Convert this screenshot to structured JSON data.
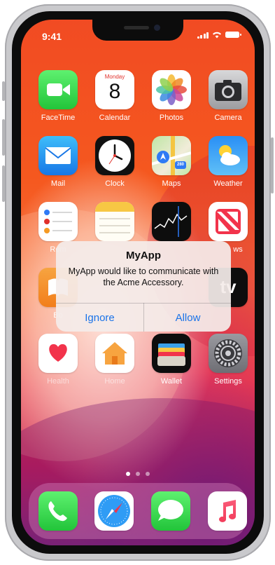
{
  "status_bar": {
    "time": "9:41"
  },
  "home": {
    "apps": [
      {
        "label": "FaceTime",
        "icon": "facetime-icon"
      },
      {
        "label": "Calendar",
        "icon": "calendar-icon",
        "calendar_day": "Monday",
        "calendar_date": "8"
      },
      {
        "label": "Photos",
        "icon": "photos-icon"
      },
      {
        "label": "Camera",
        "icon": "camera-icon"
      },
      {
        "label": "Mail",
        "icon": "mail-icon"
      },
      {
        "label": "Clock",
        "icon": "clock-icon"
      },
      {
        "label": "Maps",
        "icon": "maps-icon",
        "route_badge": "280"
      },
      {
        "label": "Weather",
        "icon": "weather-icon"
      },
      {
        "label": "Rem",
        "icon": "reminders-icon"
      },
      {
        "label": "",
        "icon": "notes-icon"
      },
      {
        "label": "",
        "icon": "stocks-icon"
      },
      {
        "label": "ws",
        "icon": "news-icon"
      },
      {
        "label": "Bo",
        "icon": "books-icon"
      },
      {
        "label": "",
        "icon": "tv-icon",
        "tv_text": "tv"
      },
      {
        "label": "Health",
        "icon": "health-icon"
      },
      {
        "label": "Home",
        "icon": "home-icon"
      },
      {
        "label": "Wallet",
        "icon": "wallet-icon"
      },
      {
        "label": "Settings",
        "icon": "settings-icon"
      }
    ],
    "dock": [
      {
        "icon": "phone-icon"
      },
      {
        "icon": "safari-icon"
      },
      {
        "icon": "messages-icon"
      },
      {
        "icon": "music-icon"
      }
    ]
  },
  "alert": {
    "title": "MyApp",
    "message": "MyApp would like to communicate with the Acme Accessory.",
    "buttons": {
      "ignore": "Ignore",
      "allow": "Allow"
    }
  },
  "colors": {
    "accent": "#1a73e8",
    "wallpaper_top": "#f14b23",
    "wallpaper_bottom": "#7a2a7c"
  }
}
